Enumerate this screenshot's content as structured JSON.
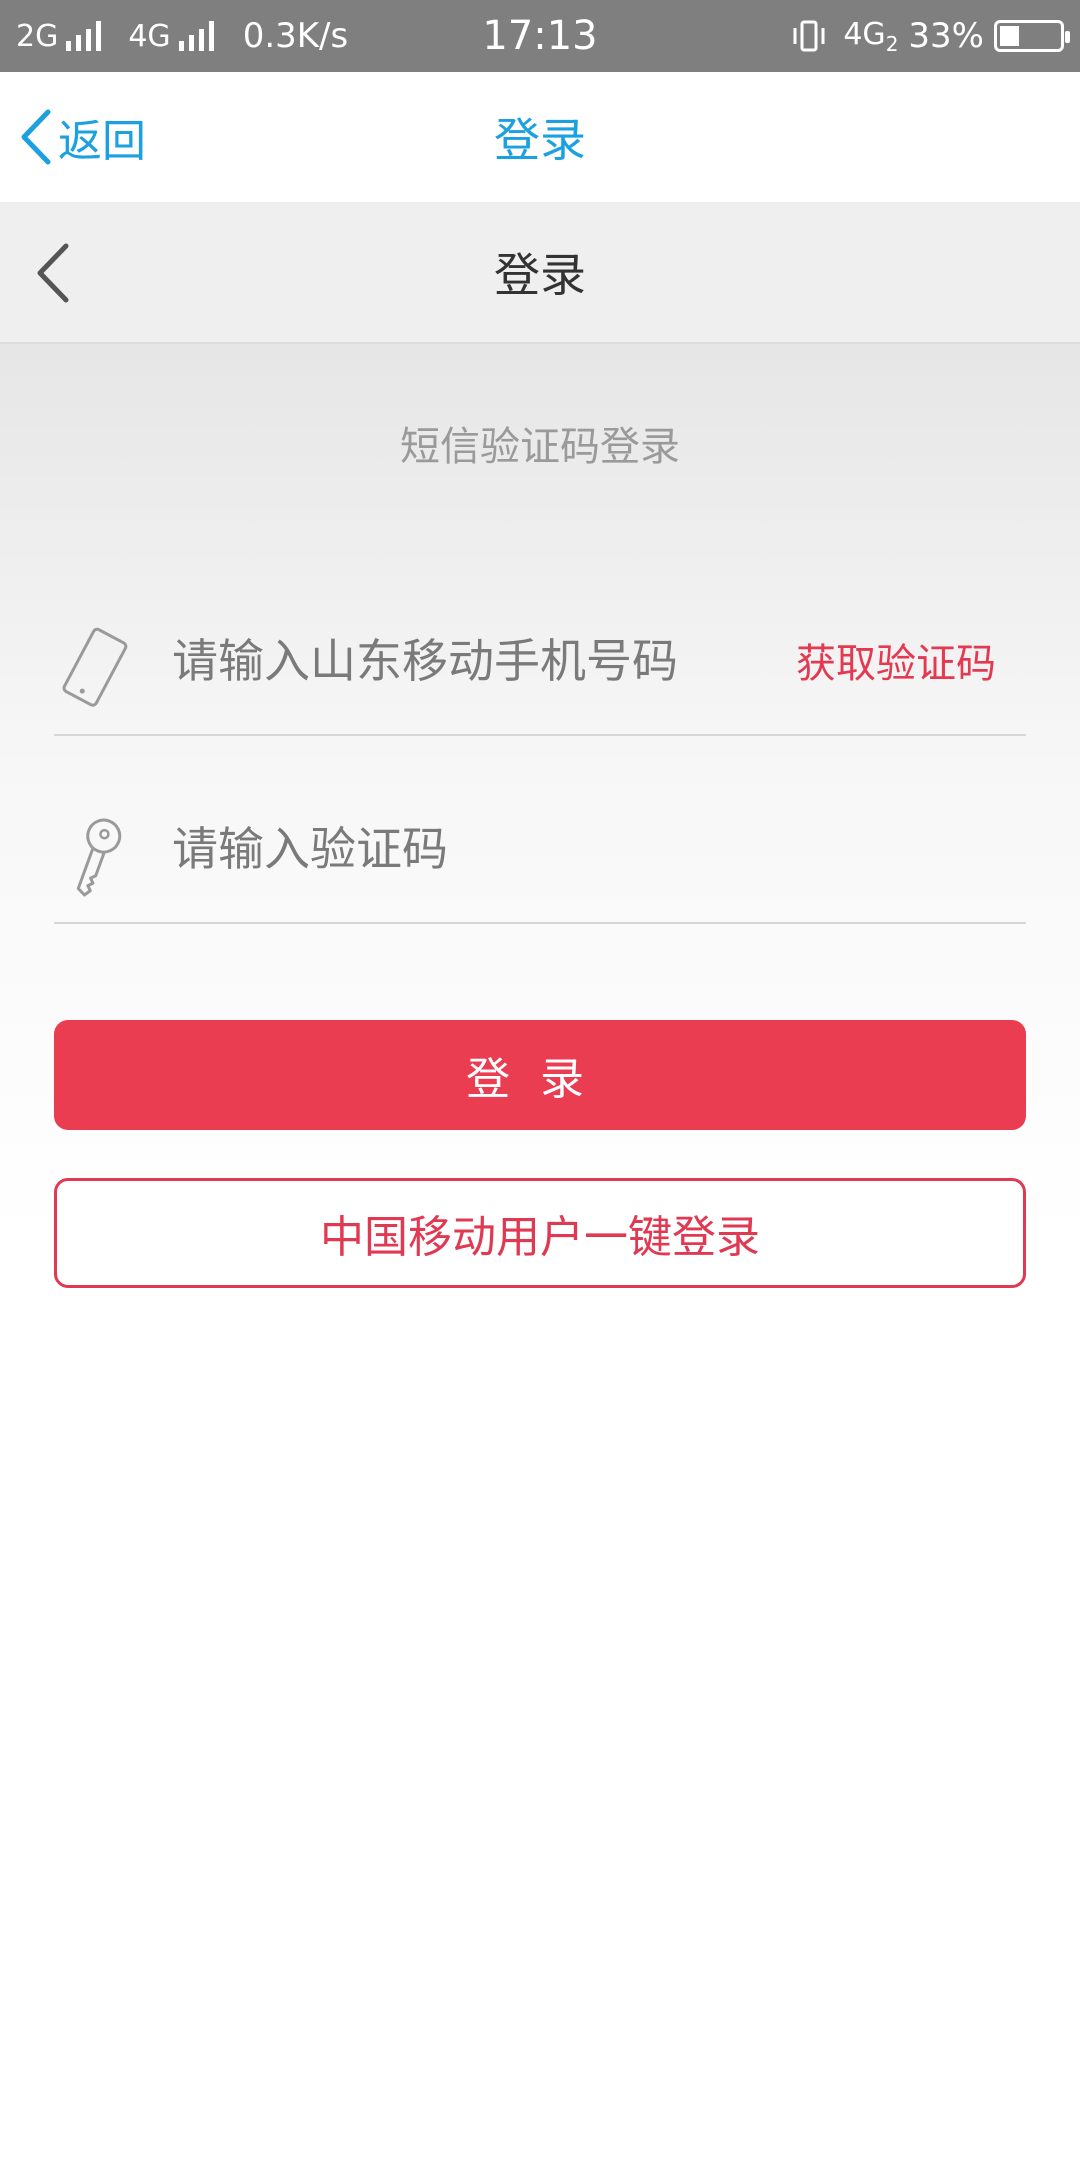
{
  "status_bar": {
    "network1": "2G",
    "network2": "4G",
    "speed": "0.3K/s",
    "time": "17:13",
    "network_right": "4G",
    "network_right_sub": "2",
    "battery": "33%",
    "battery_level": 0.33
  },
  "top_nav": {
    "back_label": "返回",
    "title": "登录"
  },
  "sub_header": {
    "title": "登录"
  },
  "login_form": {
    "method_label": "短信验证码登录",
    "phone_placeholder": "请输入山东移动手机号码",
    "get_code_label": "获取验证码",
    "code_placeholder": "请输入验证码",
    "login_button": "登录",
    "one_key_button": "中国移动用户一键登录"
  },
  "colors": {
    "accent_blue": "#1ba0e1",
    "brand_red": "#eb3d52",
    "status_bar": "#7f7f7f"
  },
  "icons": {
    "back": "chevron-left-icon",
    "phone": "phone-icon",
    "key": "key-icon"
  }
}
